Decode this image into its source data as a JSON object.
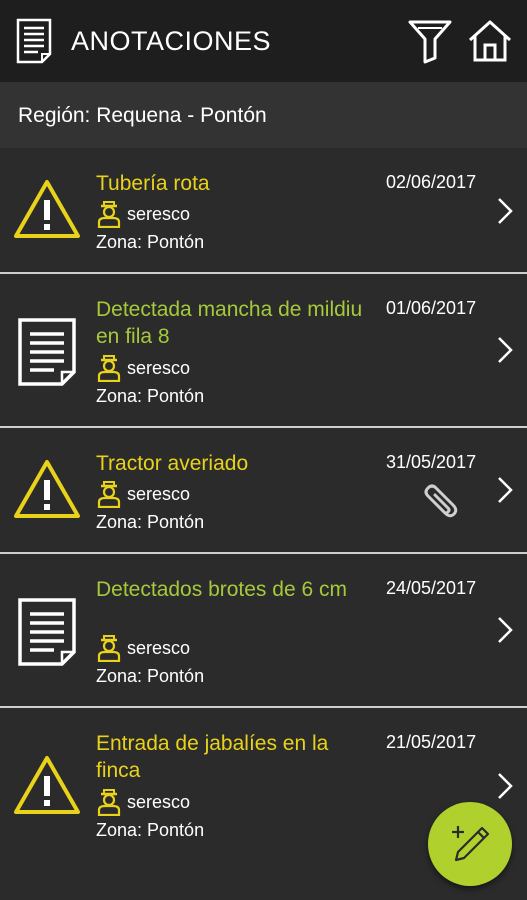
{
  "appbar": {
    "title": "ANOTACIONES",
    "icons": {
      "left": "document-icon",
      "filter": "filter-icon",
      "home": "home-icon"
    }
  },
  "region": {
    "label": "Región: Requena  -  Pontón"
  },
  "colors": {
    "warning_title": "#e8d21a",
    "note_title": "#a5c93a",
    "fab": "#b0d12d",
    "appbar_bg": "#1e1e1e",
    "list_bg": "#2b2b2b"
  },
  "annotations": [
    {
      "type": "warning",
      "icon": "warning-icon",
      "title": "Tubería rota",
      "user": "seresco",
      "zone": "Zona: Pontón",
      "date": "02/06/2017",
      "attachment": false
    },
    {
      "type": "note",
      "icon": "document-icon",
      "title": "Detectada mancha de mildiu en fila 8",
      "user": "seresco",
      "zone": "Zona: Pontón",
      "date": "01/06/2017",
      "attachment": false
    },
    {
      "type": "warning",
      "icon": "warning-icon",
      "title": "Tractor averiado",
      "user": "seresco",
      "zone": "Zona: Pontón",
      "date": "31/05/2017",
      "attachment": true
    },
    {
      "type": "note",
      "icon": "document-icon",
      "title": "Detectados brotes de 6 cm",
      "user": "seresco",
      "zone": "Zona: Pontón",
      "date": "24/05/2017",
      "attachment": false
    },
    {
      "type": "warning",
      "icon": "warning-icon",
      "title": "Entrada de jabalíes en la finca",
      "user": "seresco",
      "zone": "Zona: Pontón",
      "date": "21/05/2017",
      "attachment": false
    }
  ],
  "fab": {
    "icon": "add-note-pencil-icon"
  }
}
